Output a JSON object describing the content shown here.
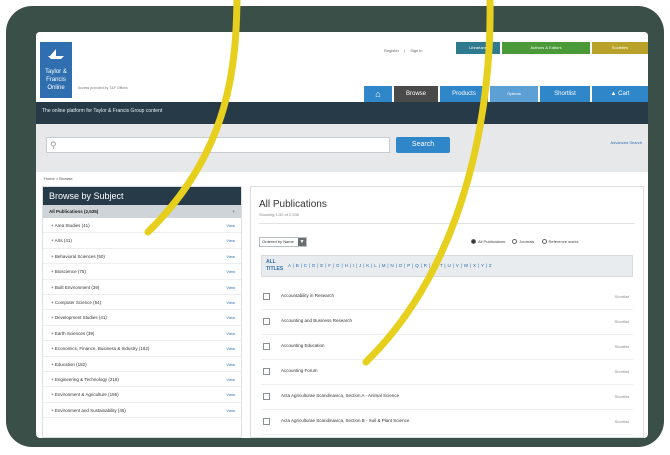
{
  "header": {
    "logo_lines": [
      "Taylor &",
      "Francis",
      "Online"
    ],
    "tagline": "Access provided by T&F Offices",
    "links": [
      "Register",
      "Sign in"
    ],
    "top_buttons": [
      {
        "label": "Librarians",
        "color": "#2f7a8e"
      },
      {
        "label": "Authors & Editors",
        "color": "#4a9a3a"
      },
      {
        "label": "Societies",
        "color": "#b9a22a"
      }
    ],
    "tabs": [
      {
        "label": "",
        "icon": "home-icon"
      },
      {
        "label": "Browse"
      },
      {
        "label": "Products"
      },
      {
        "label": "Options"
      },
      {
        "label": "Shortlist"
      },
      {
        "label": "Cart",
        "icon": "cart-icon"
      }
    ],
    "banner": "The online platform for Taylor & Francis Group content"
  },
  "search": {
    "placeholder": "",
    "button": "Search",
    "advanced": "Advanced Search"
  },
  "breadcrumb": "Home > Browse",
  "sidebar": {
    "title": "Browse by Subject",
    "all": {
      "label": "All Publications (2,535)",
      "count": "+"
    },
    "items": [
      {
        "label": "Area Studies (41)",
        "action": "View"
      },
      {
        "label": "Arts (41)",
        "action": "View"
      },
      {
        "label": "Behavioral Sciences (50)",
        "action": "View"
      },
      {
        "label": "Bioscience (75)",
        "action": "View"
      },
      {
        "label": "Built Environment (39)",
        "action": "View"
      },
      {
        "label": "Computer Science (54)",
        "action": "View"
      },
      {
        "label": "Development Studies (41)",
        "action": "View"
      },
      {
        "label": "Earth Sciences (39)",
        "action": "View"
      },
      {
        "label": "Economics, Finance, Business & Industry (182)",
        "action": "View"
      },
      {
        "label": "Education (182)",
        "action": "View"
      },
      {
        "label": "Engineering & Technology (218)",
        "action": "View"
      },
      {
        "label": "Environment & Agriculture (186)",
        "action": "View"
      },
      {
        "label": "Environment and Sustainability (45)",
        "action": "View"
      }
    ]
  },
  "main": {
    "title": "All Publications",
    "subtitle": "Showing 1-50 of 2,535",
    "select": "Ordered by Name",
    "radios": [
      {
        "label": "All Publications",
        "on": true
      },
      {
        "label": "Journals",
        "on": false
      },
      {
        "label": "Reference works",
        "on": false
      }
    ],
    "alpha_all": "ALL TITLES",
    "letters": "A | B | C | D | E | F | G | H | I | J | K | L | M | N | O | P | Q | R | S | T | U | V | W | X | Y | Z",
    "publications": [
      {
        "title": "Accountability in Research",
        "action": "Shortlist"
      },
      {
        "title": "Accounting and Business Research",
        "action": "Shortlist"
      },
      {
        "title": "Accounting Education",
        "action": "Shortlist"
      },
      {
        "title": "Accounting Forum",
        "action": "Shortlist"
      },
      {
        "title": "Acta Agriculturae Scandinavica, Section A - Animal Science",
        "action": "Shortlist"
      },
      {
        "title": "Acta Agriculturae Scandinavica, Section B - Soil & Plant Science",
        "action": "Shortlist"
      }
    ]
  },
  "colors": {
    "frame": "#3b4f49",
    "brand_blue": "#2f86c9",
    "navy": "#263a48",
    "highlighter": "#e6cf1d"
  }
}
